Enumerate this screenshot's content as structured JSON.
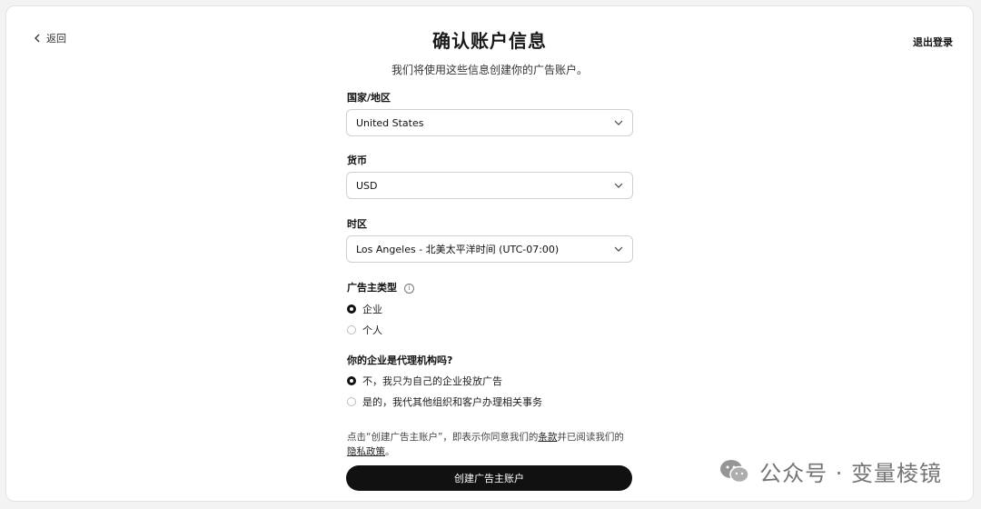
{
  "header": {
    "back_label": "返回",
    "title": "确认账户信息",
    "subtitle": "我们将使用这些信息创建你的广告账户。",
    "logout_label": "退出登录"
  },
  "fields": {
    "country": {
      "label": "国家/地区",
      "value": "United States"
    },
    "currency": {
      "label": "货币",
      "value": "USD"
    },
    "timezone": {
      "label": "时区",
      "value": "Los Angeles - 北美太平洋时间 (UTC-07:00)"
    }
  },
  "advertiser_type": {
    "label": "广告主类型",
    "info_glyph": "i",
    "options": [
      {
        "label": "企业",
        "selected": true
      },
      {
        "label": "个人",
        "selected": false
      }
    ]
  },
  "agency": {
    "label": "你的企业是代理机构吗?",
    "options": [
      {
        "label": "不，我只为自己的企业投放广告",
        "selected": true
      },
      {
        "label": "是的，我代其他组织和客户办理相关事务",
        "selected": false
      }
    ]
  },
  "terms": {
    "prefix": "点击“创建广告主账户”，即表示你同意我们的",
    "terms_link": "条款",
    "middle": "并已阅读我们的",
    "privacy_link": "隐私政策",
    "suffix": "。"
  },
  "submit_label": "创建广告主账户",
  "watermark": {
    "text": "公众号 · 变量棱镜",
    "icon": "wechat-icon"
  },
  "colors": {
    "primary": "#111111",
    "border": "#cfcfcf",
    "background": "#ffffff"
  }
}
